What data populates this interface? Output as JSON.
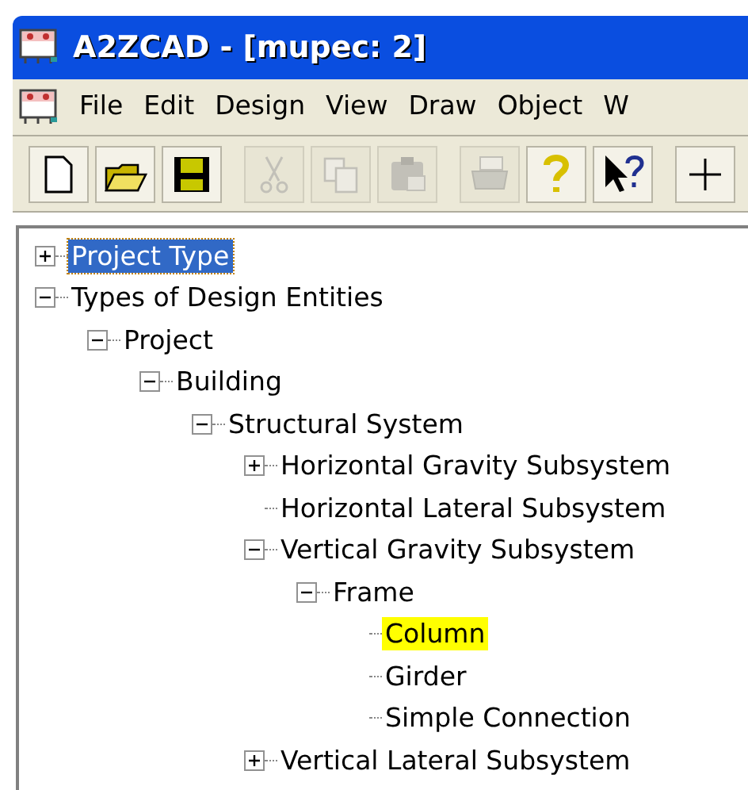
{
  "window": {
    "title": "A2ZCAD - [mupec: 2]"
  },
  "menu": [
    "File",
    "Edit",
    "Design",
    "View",
    "Draw",
    "Object",
    "W"
  ],
  "toolbar": [
    [
      {
        "disabled": false
      },
      {
        "disabled": false
      },
      {
        "disabled": false
      }
    ],
    [
      {
        "disabled": true
      },
      {
        "disabled": true
      },
      {
        "disabled": true
      }
    ],
    [
      {
        "disabled": true
      },
      {
        "disabled": false
      },
      {
        "disabled": false
      }
    ],
    [
      {
        "disabled": false
      }
    ]
  ],
  "tree": [
    {
      "label": "Project Type",
      "kind": "folder",
      "expanded": false,
      "selected": true,
      "highlighted": false
    },
    {
      "label": "Types of Design Entities",
      "kind": "folder",
      "expanded": true,
      "selected": false,
      "highlighted": false,
      "children": [
        {
          "label": "Project",
          "kind": "folder",
          "expanded": true,
          "selected": false,
          "highlighted": false,
          "children": [
            {
              "label": "Building",
              "kind": "folder",
              "expanded": true,
              "selected": false,
              "highlighted": false,
              "children": [
                {
                  "label": "Structural System",
                  "kind": "folder",
                  "expanded": true,
                  "selected": false,
                  "highlighted": false,
                  "children": [
                    {
                      "label": "Horizontal Gravity Subsystem",
                      "kind": "folder",
                      "expanded": false,
                      "selected": false,
                      "highlighted": false
                    },
                    {
                      "label": "Horizontal Lateral Subsystem",
                      "kind": "leaf",
                      "selected": false,
                      "highlighted": false
                    },
                    {
                      "label": "Vertical Gravity Subsystem",
                      "kind": "folder",
                      "expanded": true,
                      "selected": false,
                      "highlighted": false,
                      "children": [
                        {
                          "label": "Frame",
                          "kind": "folder",
                          "expanded": true,
                          "selected": false,
                          "highlighted": false,
                          "children": [
                            {
                              "label": "Column",
                              "kind": "leaf",
                              "selected": false,
                              "highlighted": true
                            },
                            {
                              "label": "Girder",
                              "kind": "leaf",
                              "selected": false,
                              "highlighted": false
                            },
                            {
                              "label": "Simple Connection",
                              "kind": "leaf",
                              "selected": false,
                              "highlighted": false
                            }
                          ]
                        }
                      ]
                    },
                    {
                      "label": "Vertical Lateral Subsystem",
                      "kind": "folder",
                      "expanded": false,
                      "selected": false,
                      "highlighted": false
                    }
                  ]
                }
              ]
            }
          ]
        }
      ]
    }
  ]
}
